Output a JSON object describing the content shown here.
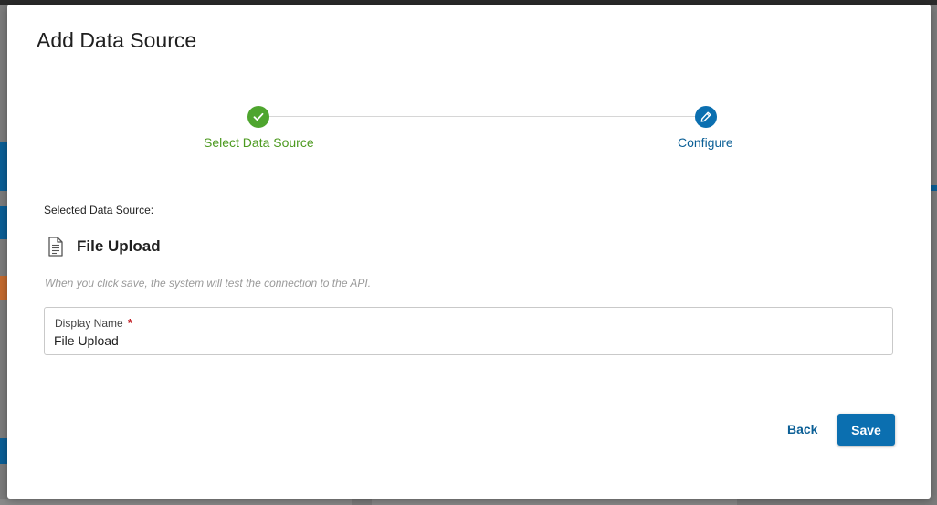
{
  "modal": {
    "title": "Add Data Source"
  },
  "stepper": {
    "steps": [
      {
        "label": "Select Data Source",
        "status": "complete"
      },
      {
        "label": "Configure",
        "status": "active"
      }
    ]
  },
  "selected_source": {
    "label": "Selected Data Source:",
    "name": "File Upload",
    "icon": "document-icon"
  },
  "hint": "When you click save, the system will test the connection to the API.",
  "display_name_field": {
    "label": "Display Name",
    "required_marker": "*",
    "value": "File Upload"
  },
  "actions": {
    "back_label": "Back",
    "save_label": "Save"
  },
  "colors": {
    "primary": "#0b6fb0",
    "success": "#4ea52e",
    "required": "#c0141a"
  }
}
